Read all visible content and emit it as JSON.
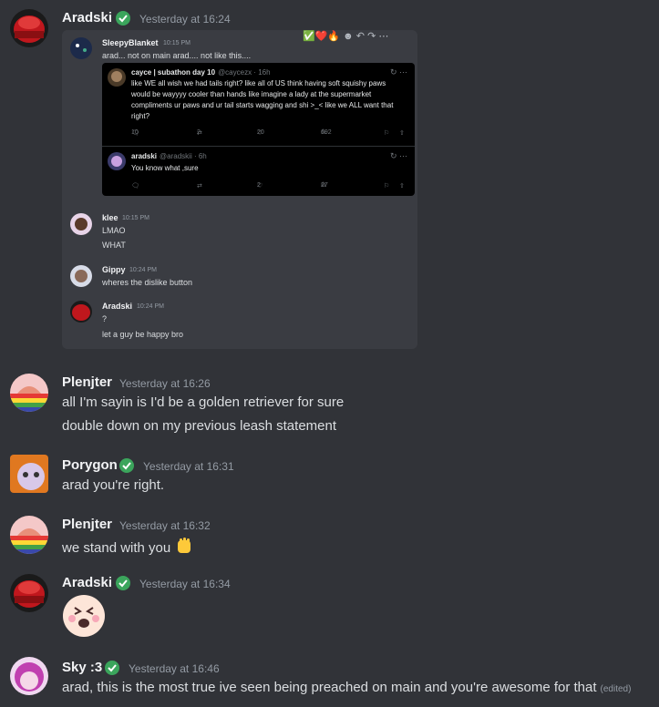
{
  "messages": [
    {
      "username": "Aradski",
      "timestamp": "Yesterday at 16:24"
    },
    {
      "username": "Plenjter",
      "timestamp": "Yesterday at 16:26",
      "lines": [
        "all I'm sayin is I'd be a golden retriever for sure",
        "double down on my previous leash statement"
      ]
    },
    {
      "username": "Porygon",
      "timestamp": "Yesterday at 16:31",
      "lines": [
        "arad you're right."
      ]
    },
    {
      "username": "Plenjter",
      "timestamp": "Yesterday at 16:32",
      "lines": [
        "we stand with you"
      ]
    },
    {
      "username": "Aradski",
      "timestamp": "Yesterday at 16:34"
    },
    {
      "username": "Sky :3",
      "timestamp": "Yesterday at 16:46",
      "lines": [
        "arad, this is the most true ive seen being preached on main and you're awesome for that"
      ],
      "edited": "(edited)"
    }
  ],
  "embed": {
    "reactions": "✅❤️🔥",
    "messages": [
      {
        "username": "SleepyBlanket",
        "time": "10:15 PM",
        "lines": [
          "arad... not on main arad.... not like this...."
        ]
      },
      {
        "username": "klee",
        "time": "10:15 PM",
        "lines": [
          "LMAO",
          "WHAT"
        ]
      },
      {
        "username": "Gippy",
        "time": "10:24 PM",
        "lines": [
          "wheres the dislike button"
        ]
      },
      {
        "username": "Aradski",
        "time": "10:24 PM",
        "lines": [
          "?",
          "let a guy be happy bro"
        ]
      }
    ],
    "tweets": [
      {
        "name": "cayce | subathon day 10",
        "handle": "@caycezx · 16h",
        "body": "like WE all wish we had tails right? like all of US think having soft squishy paws would be wayyyy cooler than hands like imagine a lady at the supermarket compliments ur paws and ur tail starts wagging and shi >_< like we ALL want that right?",
        "replies": "10",
        "retweets": "2",
        "likes": "20",
        "views": "692"
      },
      {
        "name": "aradski",
        "handle": "@aradskii · 6h",
        "body": "You know what ,sure",
        "replies": "",
        "retweets": "",
        "likes": "2",
        "views": "27"
      }
    ]
  },
  "colors": {
    "background": "#313338",
    "embed_bg": "#3a3c42",
    "badge": "#3ba55c",
    "username": "#f2f3f5",
    "timestamp": "#949ba4"
  }
}
